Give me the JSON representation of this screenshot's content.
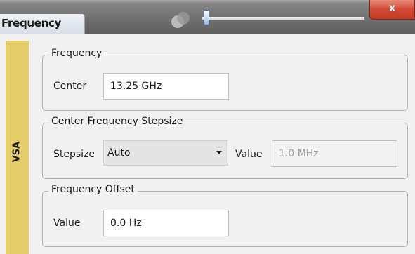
{
  "window": {
    "title": "Frequency",
    "close_label": "x",
    "view_slider_value": 0
  },
  "side_tab": {
    "label": "VSA"
  },
  "frequency": {
    "group_title": "Frequency",
    "center_label": "Center",
    "center_value": "13.25 GHz"
  },
  "stepsize": {
    "group_title": "Center Frequency Stepsize",
    "stepsize_label": "Stepsize",
    "stepsize_selected": "Auto",
    "value_label": "Value",
    "value_value": "1.0 MHz"
  },
  "offset": {
    "group_title": "Frequency Offset",
    "value_label": "Value",
    "value_value": "0.0 Hz"
  },
  "colors": {
    "side_tab": "#e6cf6a",
    "close_button": "#d24a33",
    "titlebar": "#6e6e6e"
  }
}
